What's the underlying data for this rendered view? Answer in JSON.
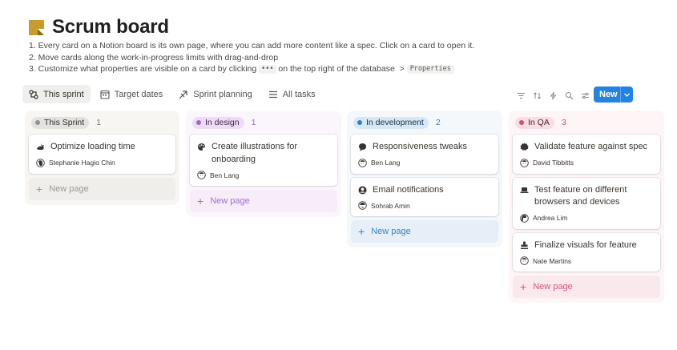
{
  "page": {
    "title": "Scrum board",
    "steps": [
      "1. Every card on a Notion board is its own page, where you can add more content like a spec. Click on a card to open it.",
      "2. Move cards along the work-in-progress limits with drag-and-drop",
      "3. Customize what properties are visible on a card by clicking"
    ],
    "step3_dots": "•••",
    "step3_after": "on the top right of the database",
    "step3_arrow": ">",
    "step3_properties": "Properties"
  },
  "views": [
    {
      "label": "This sprint",
      "icon": "sprint-icon"
    },
    {
      "label": "Target dates",
      "icon": "calendar-icon"
    },
    {
      "label": "Sprint planning",
      "icon": "sprint-planning-icon"
    },
    {
      "label": "All tasks",
      "icon": "list-icon"
    }
  ],
  "toolbar": {
    "new_label": "New",
    "icons": [
      "filter-icon",
      "sort-icon",
      "lightning-icon",
      "search-icon",
      "settings-sliders-icon",
      "chevron-down-icon"
    ]
  },
  "columns": [
    {
      "status": "This Sprint",
      "count": "1",
      "colors": {
        "bg": "#f7f6f3",
        "pill": "#e3e2e0",
        "dot": "#91918e",
        "text": "#32302c",
        "count": "#787774",
        "newpage": "#9b9a97",
        "newpage_bg": "#efeeeb"
      },
      "cards": [
        {
          "title": "Optimize loading time",
          "icon": "rabbit-icon",
          "person": "Stephanie Hagio Chin"
        }
      ],
      "new_page": "New page"
    },
    {
      "status": "In design",
      "count": "1",
      "colors": {
        "bg": "#fbf6fc",
        "pill": "#eddcf3",
        "dot": "#9d68d3",
        "text": "#412454",
        "count": "#9d68d3",
        "newpage": "#a26fd4",
        "newpage_bg": "#f6edf8"
      },
      "cards": [
        {
          "title": "Create illustrations for onboarding",
          "icon": "palette-icon",
          "person": "Ben Lang"
        }
      ],
      "new_page": "New page"
    },
    {
      "status": "In development",
      "count": "2",
      "colors": {
        "bg": "#f4f8fb",
        "pill": "#d6e7f5",
        "dot": "#2f80c3",
        "text": "#183347",
        "count": "#2f80c3",
        "newpage": "#3b83c0",
        "newpage_bg": "#e6eff7"
      },
      "cards": [
        {
          "title": "Responsiveness tweaks",
          "icon": "chat-icon",
          "person": "Ben Lang"
        },
        {
          "title": "Email notifications",
          "icon": "user-circle-icon",
          "person": "Sohrab Amin"
        }
      ],
      "new_page": "New page"
    },
    {
      "status": "In QA",
      "count": "3",
      "colors": {
        "bg": "#fdf5f6",
        "pill": "#f9dde3",
        "dot": "#d44c72",
        "text": "#4c2337",
        "count": "#d44c72",
        "newpage": "#d3587b",
        "newpage_bg": "#f9e9ec"
      },
      "cards": [
        {
          "title": "Validate feature against spec",
          "icon": "badge-icon",
          "person": "David Tibbitts"
        },
        {
          "title": "Test feature on different browsers and devices",
          "icon": "laptop-icon",
          "person": "Andrea Lim"
        },
        {
          "title": "Finalize visuals for feature",
          "icon": "stamp-icon",
          "person": "Nate Martins"
        }
      ],
      "new_page": "New page"
    }
  ]
}
